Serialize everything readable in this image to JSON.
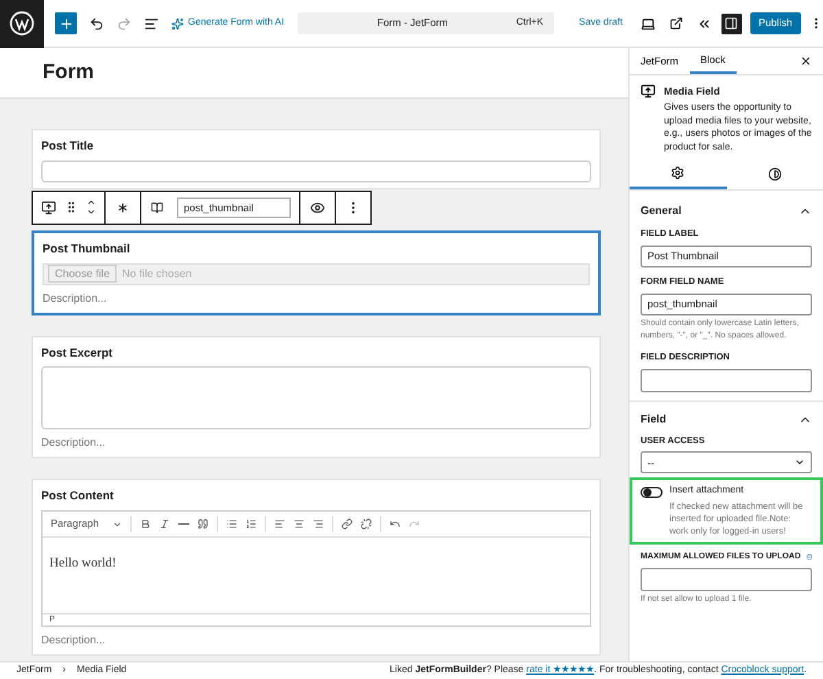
{
  "topbar": {
    "generate_label": "Generate Form with AI",
    "command": {
      "title": "Form - JetForm",
      "shortcut": "Ctrl+K"
    },
    "save_draft": "Save draft",
    "publish": "Publish"
  },
  "editor": {
    "title": "Form",
    "block_toolbar": {
      "field_name": "post_thumbnail"
    },
    "fields": [
      {
        "kind": "text",
        "label": "Post Title",
        "selected": false
      },
      {
        "kind": "media",
        "label": "Post Thumbnail",
        "selected": true,
        "choose": "Choose file",
        "status": "No file chosen",
        "description": "Description..."
      },
      {
        "kind": "textarea",
        "label": "Post Excerpt",
        "selected": false,
        "description": "Description..."
      },
      {
        "kind": "wysiwyg",
        "label": "Post Content",
        "selected": false,
        "format": "Paragraph",
        "text": "Hello world!",
        "path": "P",
        "description": "Description..."
      }
    ]
  },
  "sidebar": {
    "tabs": [
      {
        "label": "JetForm",
        "selected": false
      },
      {
        "label": "Block",
        "selected": true
      }
    ],
    "block": {
      "title": "Media Field",
      "description": "Gives users the opportunity to upload media files to your website, e.g., users photos or images of the product for sale."
    },
    "subtabs": [
      {
        "kind": "settings",
        "selected": true
      },
      {
        "kind": "styles",
        "selected": false
      }
    ],
    "general": {
      "title": "General",
      "expanded": true,
      "field_label": {
        "label": "FIELD LABEL",
        "value": "Post Thumbnail"
      },
      "form_field_name": {
        "label": "FORM FIELD NAME",
        "value": "post_thumbnail",
        "help": "Should contain only lowercase Latin letters, numbers, \"-\", or \"_\". No spaces allowed."
      },
      "field_description": {
        "label": "FIELD DESCRIPTION"
      }
    },
    "field": {
      "title": "Field",
      "expanded": true,
      "user_access": {
        "label": "USER ACCESS",
        "value": "--"
      },
      "insert_attachment": {
        "label": "Insert attachment",
        "on": false,
        "help": "If checked new attachment will be inserted for uploaded file.Note: work only for logged-in users!"
      },
      "max_files": {
        "label": "MAXIMUM ALLOWED FILES TO UPLOAD",
        "help": "If not set allow to upload 1 file."
      }
    }
  },
  "footer": {
    "breadcrumbs": [
      "JetForm",
      "Media Field"
    ],
    "separator": "›",
    "message": "Liked **JetFormBuilder**? Please",
    "rate_link": "rate it ★★★★★",
    "middle": ". For troubleshooting, contact",
    "support_link": "Crocoblock support",
    "end": "."
  }
}
